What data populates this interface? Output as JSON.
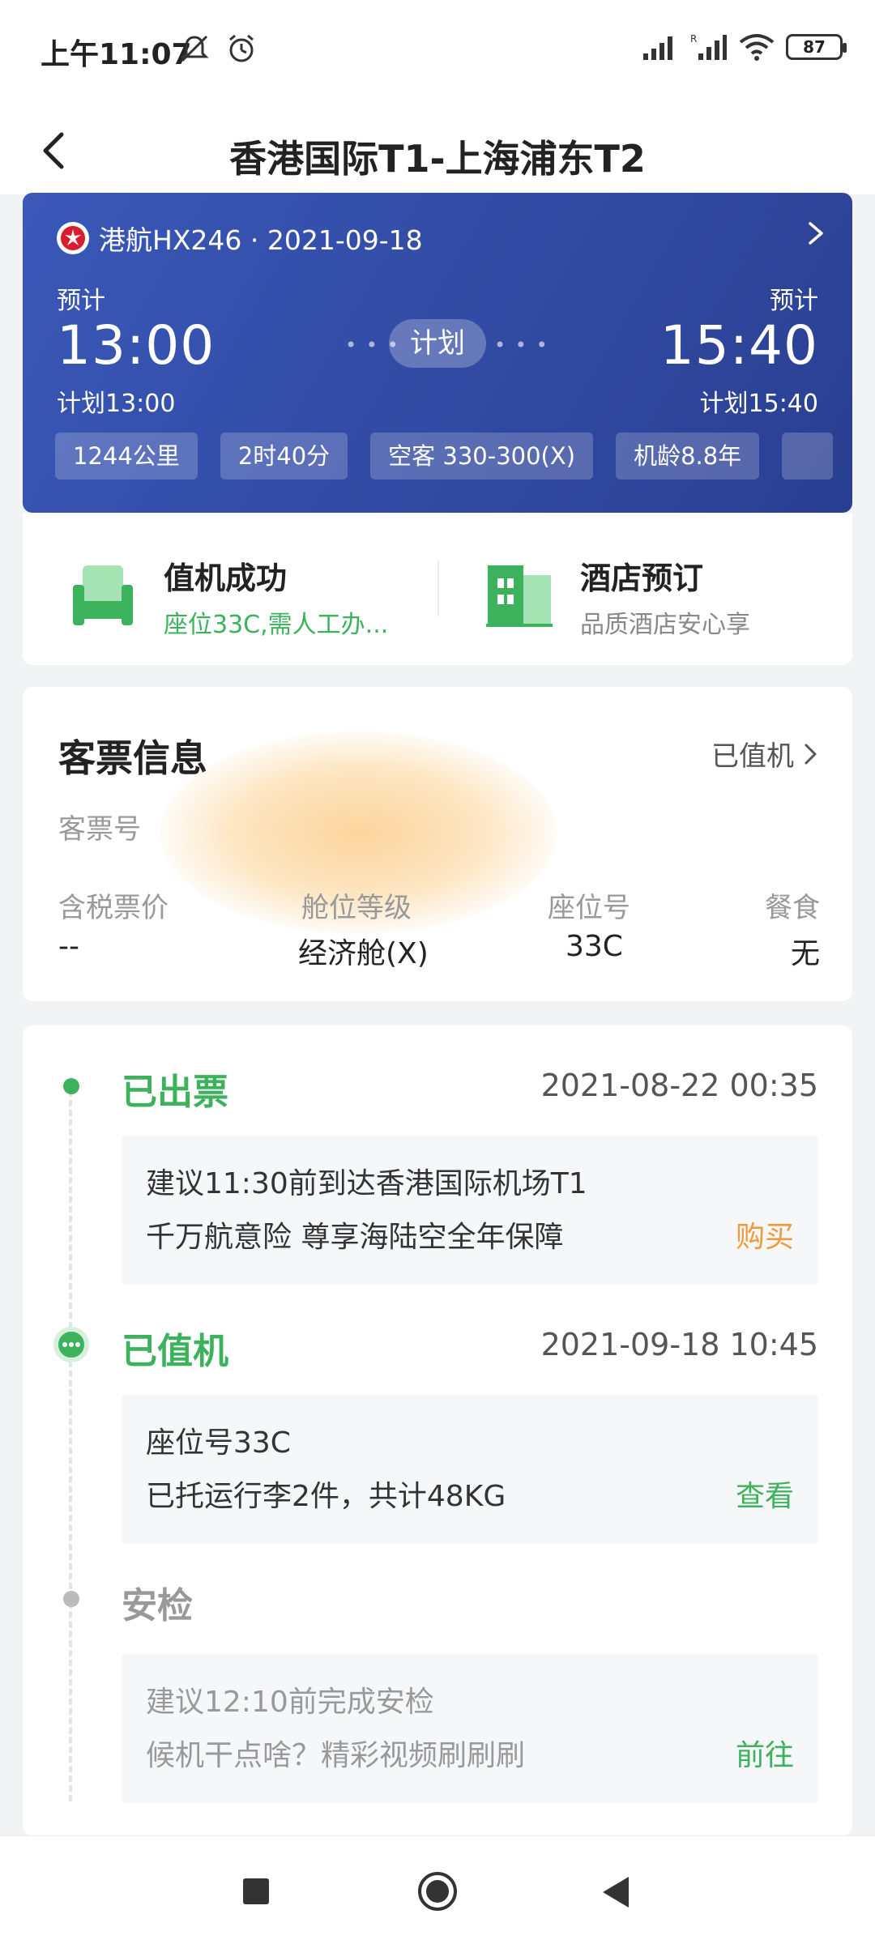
{
  "status_bar": {
    "time": "上午11:07",
    "battery": "87"
  },
  "header": {
    "title": "香港国际T1-上海浦东T2"
  },
  "flight": {
    "airline_flight": "港航HX246 · 2021-09-18",
    "dep_est_label": "预计",
    "arr_est_label": "预计",
    "dep_time": "13:00",
    "arr_time": "15:40",
    "dep_plan": "计划13:00",
    "arr_plan": "计划15:40",
    "status": "计划",
    "chips": [
      "1244公里",
      "2时40分",
      "空客 330-300(X)",
      "机龄8.8年"
    ]
  },
  "services": {
    "checkin_title": "值机成功",
    "checkin_sub": "座位33C,需人工办...",
    "hotel_title": "酒店预订",
    "hotel_sub": "品质酒店安心享"
  },
  "ticket": {
    "title": "客票信息",
    "status": "已值机",
    "ticket_no_label": "客票号",
    "columns": [
      {
        "label": "含税票价",
        "value": "--"
      },
      {
        "label": "舱位等级",
        "value": "经济舱(X)"
      },
      {
        "label": "座位号",
        "value": "33C"
      },
      {
        "label": "餐食",
        "value": "无"
      }
    ]
  },
  "timeline": [
    {
      "title": "已出票",
      "time": "2021-08-22 00:35",
      "line1": "建议11:30前到达香港国际机场T1",
      "line2": "千万航意险 尊享海陆空全年保障",
      "action": "购买"
    },
    {
      "title": "已值机",
      "time": "2021-09-18 10:45",
      "line1": "座位号33C",
      "line2": "已托运行李2件，共计48KG",
      "action": "查看"
    },
    {
      "title": "安检",
      "time": "",
      "line1": "建议12:10前完成安检",
      "line2": "候机干点啥？精彩视频刷刷刷",
      "action": "前往"
    }
  ],
  "colors": {
    "accent_green": "#3cb25d",
    "orange": "#f29a3a",
    "card_blue": "#2f4aa4"
  }
}
